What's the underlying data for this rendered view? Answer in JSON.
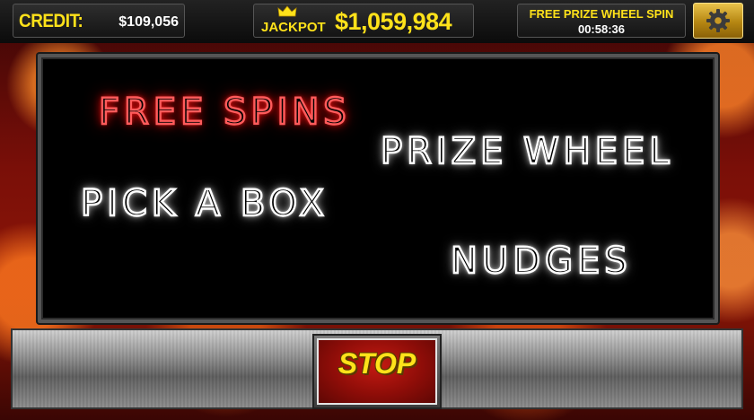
{
  "header": {
    "credit_label": "CREDIT:",
    "credit_value": "$109,056",
    "jackpot_label": "JACKPOT",
    "jackpot_value": "$1,059,984",
    "prize_wheel_label": "FREE PRIZE WHEEL SPIN",
    "prize_wheel_timer": "00:58:36",
    "settings_icon": "gear-icon",
    "crown_icon": "crown-icon"
  },
  "screen": {
    "features": [
      {
        "label": "FREE SPINS",
        "lit": true
      },
      {
        "label": "PRIZE WHEEL",
        "lit": false
      },
      {
        "label": "PICK A BOX",
        "lit": false
      },
      {
        "label": "NUDGES",
        "lit": false
      }
    ]
  },
  "controls": {
    "stop_label": "STOP"
  },
  "colors": {
    "accent_yellow": "#ffe21a",
    "neon_red": "#ff3030",
    "neon_white": "#ffffff",
    "settings_gold": "#c99a24",
    "stop_red": "#a8130c"
  }
}
